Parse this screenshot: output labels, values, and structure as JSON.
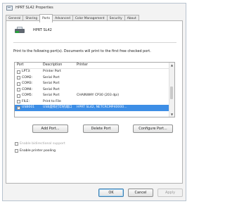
{
  "window": {
    "title": "HPRT SL42 Properties"
  },
  "tabs": [
    "General",
    "Sharing",
    "Ports",
    "Advanced",
    "Color Management",
    "Security",
    "About"
  ],
  "printer": {
    "name": "HPRT SL42"
  },
  "info_text": "Print to the following port(s). Documents will print to the first free checked port.",
  "table": {
    "headers": {
      "port": "Port",
      "description": "Description",
      "printer": "Printer"
    },
    "rows": [
      {
        "port": "LPT3:",
        "description": "Printer Port",
        "printer": "",
        "checked": false,
        "selected": false
      },
      {
        "port": "COM2:",
        "description": "Serial Port",
        "printer": "",
        "checked": false,
        "selected": false
      },
      {
        "port": "COM3:",
        "description": "Serial Port",
        "printer": "",
        "checked": false,
        "selected": false
      },
      {
        "port": "COM4:",
        "description": "Serial Port",
        "printer": "",
        "checked": false,
        "selected": false
      },
      {
        "port": "COM5:",
        "description": "Serial Port",
        "printer": "CHAINWAY CP30 (203 dpi)",
        "checked": false,
        "selected": false
      },
      {
        "port": "FILE:",
        "description": "Print to File",
        "printer": "",
        "checked": false,
        "selected": false
      },
      {
        "port": "USB001",
        "description": "USB虚拟打印机端口",
        "printer": "HPRT SL42, NETCRCMP40000...",
        "checked": true,
        "selected": true
      }
    ]
  },
  "buttons": {
    "add_port": "Add Port...",
    "delete_port": "Delete Port",
    "configure_port": "Configure Port...",
    "ok": "OK",
    "cancel": "Cancel",
    "apply": "Apply"
  },
  "options": {
    "bidirectional": {
      "label": "Enable bidirectional support",
      "enabled": false,
      "checked": false
    },
    "pooling": {
      "label": "Enable printer pooling",
      "enabled": true,
      "checked": false
    }
  },
  "colors": {
    "selection": "#3d8ee6",
    "default_button_border": "#3c7fb1"
  },
  "icons": {
    "app": "printer-app-icon",
    "printer": "printer-icon",
    "check": "checkmark-icon"
  }
}
